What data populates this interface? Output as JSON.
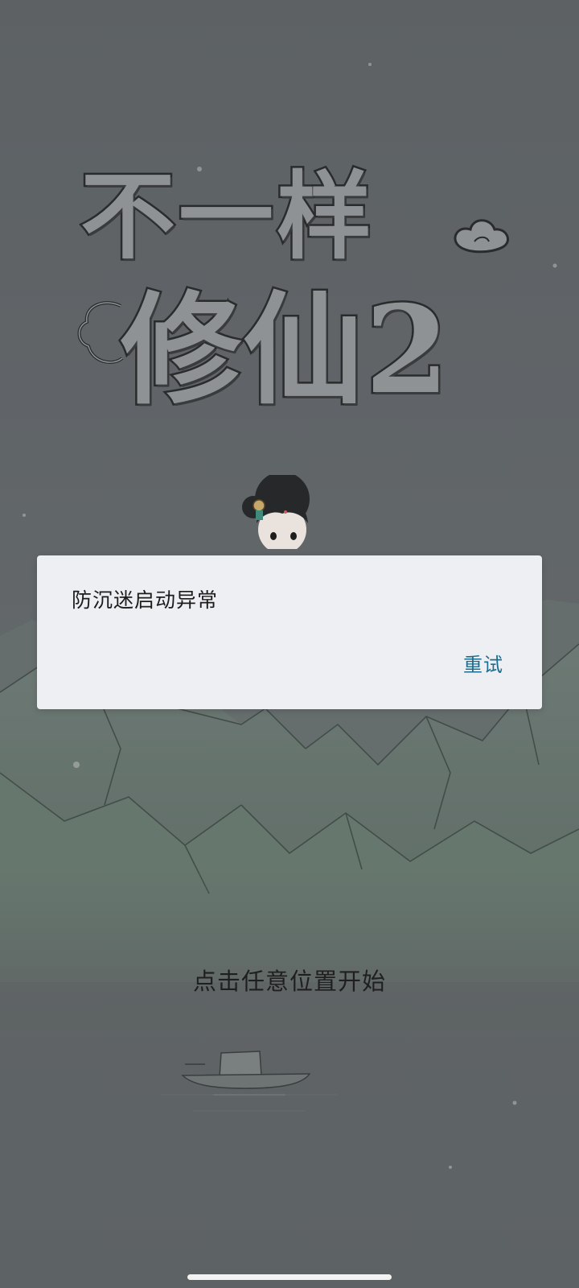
{
  "game": {
    "title_line_1": "不一样",
    "title_line_2": "修仙2",
    "start_prompt": "点击任意位置开始"
  },
  "dialog": {
    "message": "防沉迷启动异常",
    "retry_label": "重试",
    "retry_color": "#1b6d91"
  },
  "colors": {
    "background": "#5f6366",
    "dialog_background": "#eeeff2"
  }
}
